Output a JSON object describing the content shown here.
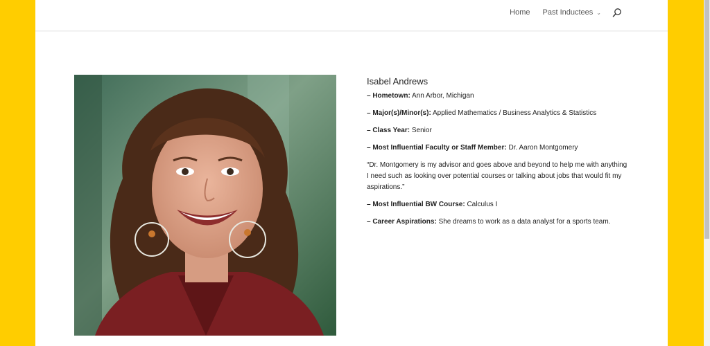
{
  "nav": {
    "home": "Home",
    "past_inductees": "Past Inductees"
  },
  "profile": {
    "name": "Isabel Andrews",
    "hometown_label": "– Hometown:",
    "hometown": "Ann Arbor, Michigan",
    "major_label": "– Major(s)/Minor(s):",
    "major": "Applied Mathematics / Business Analytics & Statistics",
    "class_year_label": "– Class Year:",
    "class_year": "Senior",
    "faculty_label": "– Most Influential Faculty or Staff Member:",
    "faculty": "Dr. Aaron Montgomery",
    "quote": "“Dr. Montgomery is my advisor and goes above and beyond to help me with anything I need such as looking over potential courses or talking about jobs that would fit my aspirations.”",
    "course_label": "– Most Influential BW Course:",
    "course": "Calculus I",
    "career_label": "– Career Aspirations:",
    "career": "She dreams to work as a data analyst for a sports team."
  },
  "colors": {
    "background": "#ffcd00",
    "page": "#ffffff",
    "text": "#222222"
  },
  "icons": {
    "search": "search-icon",
    "chevron": "chevron-down-icon"
  }
}
